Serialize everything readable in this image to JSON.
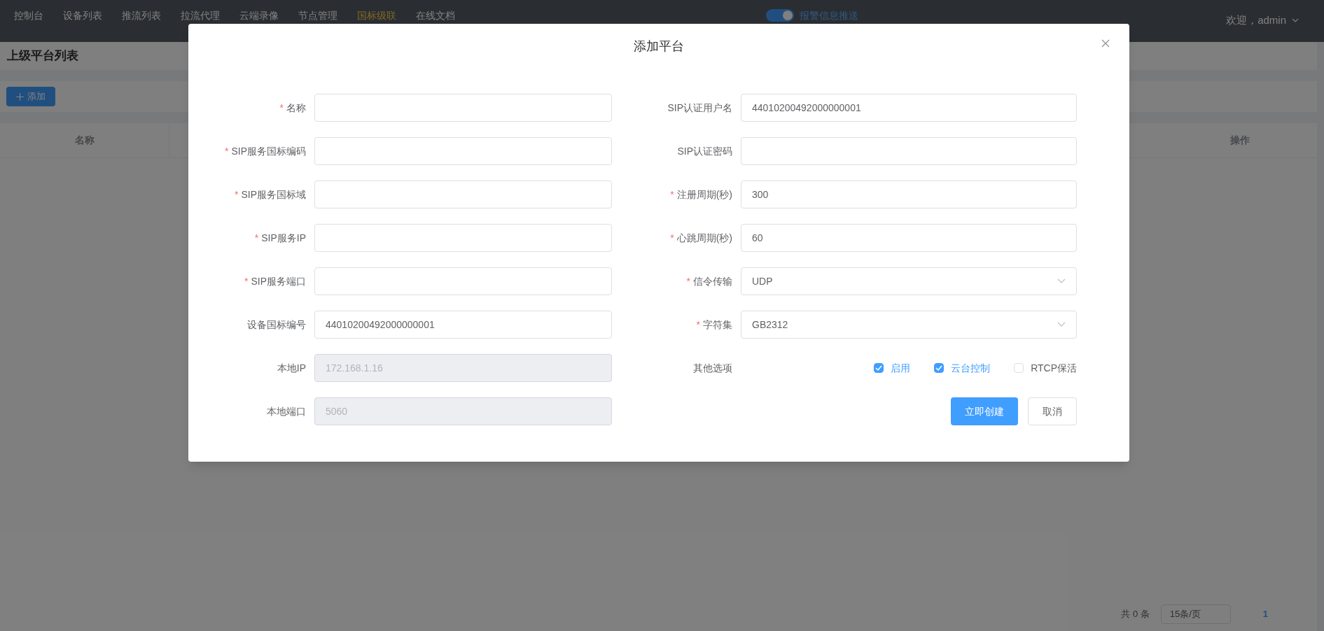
{
  "nav": {
    "items": [
      {
        "label": "控制台",
        "selected": false
      },
      {
        "label": "设备列表",
        "selected": false
      },
      {
        "label": "推流列表",
        "selected": false
      },
      {
        "label": "拉流代理",
        "selected": false
      },
      {
        "label": "云端录像",
        "selected": false
      },
      {
        "label": "节点管理",
        "selected": false
      },
      {
        "label": "国标级联",
        "selected": true
      },
      {
        "label": "在线文档",
        "selected": false
      }
    ],
    "alarm_switch": {
      "label": "报警信息推送",
      "on": true
    },
    "user": "欢迎，admin"
  },
  "page": {
    "title": "上级平台列表",
    "add_button": "添加",
    "table": {
      "columns": [
        "名称",
        "操作"
      ]
    },
    "pagination": {
      "total": "共 0 条",
      "page_size": "15条/页",
      "current": "1"
    }
  },
  "dialog": {
    "title": "添加平台",
    "left_fields": [
      {
        "label": "名称",
        "required_mark": "*",
        "disabled": false
      },
      {
        "label": "SIP服务国标编码",
        "required_mark": "*",
        "disabled": false
      },
      {
        "label": "SIP服务国标域",
        "required_mark": "*",
        "disabled": false
      },
      {
        "label": "SIP服务IP",
        "required_mark": "*",
        "disabled": false
      },
      {
        "label": "SIP服务端口",
        "required_mark": "*",
        "disabled": false
      },
      {
        "label": "设备国标编号",
        "value": "44010200492000000001",
        "disabled": false
      },
      {
        "label": "本地IP",
        "value": "172.168.1.16",
        "disabled": true
      },
      {
        "label": "本地端口",
        "value": "5060",
        "disabled": true
      }
    ],
    "right_fields": [
      {
        "kind": "input",
        "label": "SIP认证用户名",
        "value": "44010200492000000001"
      },
      {
        "kind": "input",
        "label": "SIP认证密码"
      },
      {
        "kind": "input",
        "label": "注册周期(秒)",
        "required_mark": "*",
        "value": "300"
      },
      {
        "kind": "input",
        "label": "心跳周期(秒)",
        "required_mark": "*",
        "value": "60"
      },
      {
        "kind": "select",
        "label": "信令传输",
        "required_mark": "*",
        "value": "UDP"
      },
      {
        "kind": "select",
        "label": "字符集",
        "required_mark": "*",
        "value": "GB2312"
      },
      {
        "kind": "checkboxes",
        "label": "其他选项",
        "options": [
          {
            "label": "启用",
            "checked": true
          },
          {
            "label": "云台控制",
            "checked": true
          },
          {
            "label": "RTCP保活",
            "checked": false
          }
        ]
      }
    ],
    "buttons": [
      {
        "label": "立即创建",
        "kind": "primary"
      },
      {
        "label": "取消",
        "kind": "default"
      }
    ]
  }
}
